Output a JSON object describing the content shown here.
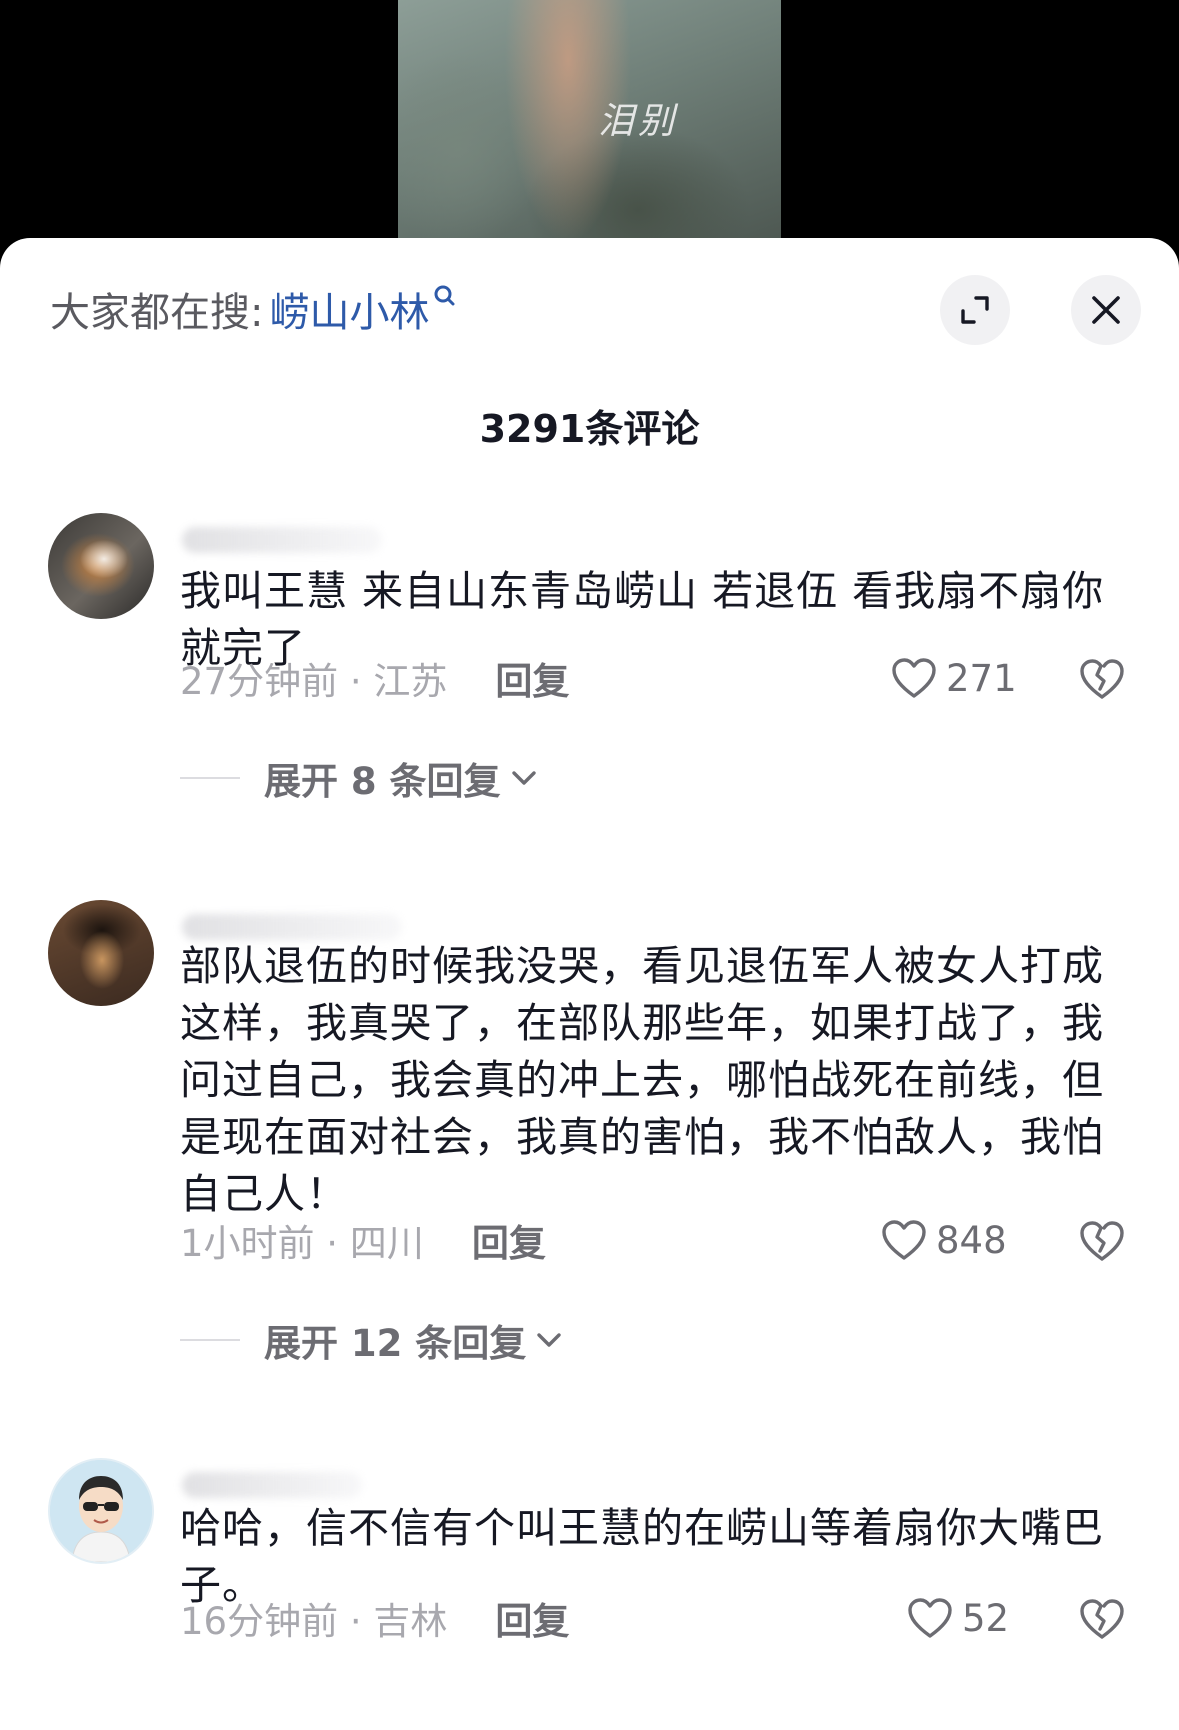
{
  "video": {
    "caption": "泪别"
  },
  "header": {
    "search_prefix": "大家都在搜:",
    "search_term": "崂山小林",
    "search_icon": "search-icon",
    "expand_icon": "fullscreen-expand-icon",
    "close_icon": "close-icon"
  },
  "comment_count_label": "3291条评论",
  "comments": [
    {
      "avatar": "dog-avatar",
      "text": "我叫王慧 来自山东青岛崂山 若退伍 看我扇不扇你就完了",
      "time_location": "27分钟前 · 江苏",
      "reply_label": "回复",
      "likes": "271",
      "expand_replies": "展开 8 条回复"
    },
    {
      "avatar": "man-avatar",
      "text": "部队退伍的时候我没哭，看见退伍军人被女人打成这样，我真哭了，在部队那些年，如果打战了，我问过自己，我会真的冲上去，哪怕战死在前线，但是现在面对社会，我真的害怕，我不怕敌人，我怕自己人！",
      "time_location": "1小时前 · 四川",
      "reply_label": "回复",
      "likes": "848",
      "expand_replies": "展开 12 条回复"
    },
    {
      "avatar": "cartoon-avatar",
      "text": "哈哈，信不信有个叫王慧的在崂山等着扇你大嘴巴子。",
      "time_location": "16分钟前 · 吉林",
      "reply_label": "回复",
      "likes": "52"
    }
  ],
  "colors": {
    "accent_link": "#2e5aa9",
    "text_primary": "#161823",
    "text_secondary": "#6c6c72",
    "text_muted": "#a8a8ae"
  }
}
